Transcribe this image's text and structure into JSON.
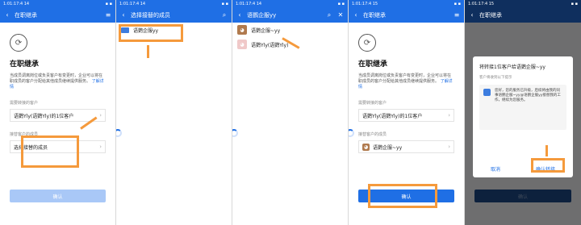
{
  "status": {
    "time_a": "1:01:17:4 14",
    "time_b": "1:01:17:4 14",
    "time_c": "1:01:17:4 14",
    "time_d": "1:01:17:4 15",
    "time_e": "1:01:17:4 15"
  },
  "screens": [
    {
      "title": "在职继承",
      "heading": "在职继承",
      "description": "当成员调离岗位或负责客户有变更时，企业可以将在职成员的客户分配给其他成员继续提供服务。",
      "learn_more": "了解详情",
      "clients_label": "需要转接的客户",
      "clients_value": "语鹦Yly(语鹦Yly)的1位客户",
      "receiver_label": "接替客户的成员",
      "receiver_placeholder": "选择接替的成员",
      "confirm_label": "确认"
    },
    {
      "title": "选择接替的成员",
      "rows": [
        {
          "name": "语鹦企服yy"
        }
      ]
    },
    {
      "title": "语鹦企服yy",
      "rows": [
        {
          "name": "语鹦企服~yy"
        },
        {
          "name": "语鹦Yly(语鹦Yly)"
        }
      ]
    },
    {
      "title": "在职继承",
      "heading": "在职继承",
      "description": "当成员调离岗位或负责客户有变更时，企业可以将在职成员的客户分配给其他成员继续提供服务。",
      "learn_more": "了解详情",
      "clients_label": "需要转接的客户",
      "clients_value": "语鹦Yly(语鹦Yly)的1位客户",
      "receiver_label": "接替客户的成员",
      "receiver_value": "语鹦企服~yy",
      "confirm_label": "确认"
    },
    {
      "title": "在职继承",
      "dialog_title": "将转接1位客户给语鹦企服~yy",
      "dialog_sub": "客户将收到以下提示",
      "card_text": "您好，您的服务已升级，后续将由我的同事语鹦企服~yy@语鹦企服yy接替我的工作，继续为您服务。",
      "cancel_label": "取消",
      "confirm_transfer_label": "确认转接",
      "confirm_label": "确认"
    }
  ],
  "colors": {
    "primary": "#1f6fe5",
    "callout": "#f59a3c"
  }
}
